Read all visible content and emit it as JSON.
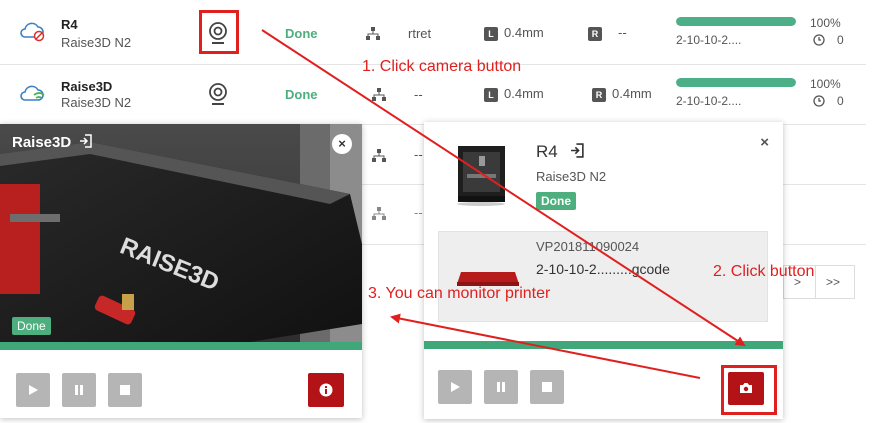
{
  "rows": [
    {
      "name": "R4",
      "model": "Raise3D N2",
      "status": "Done",
      "job": "rtret",
      "nozzle_left_tag": "L",
      "nozzle_left": "0.4mm",
      "nozzle_right_tag": "R",
      "nozzle_right": "--",
      "progress": 1.0,
      "progress_text": "100%",
      "file": "2-10-10-2....",
      "time": "0"
    },
    {
      "name": "Raise3D",
      "model": "Raise3D N2",
      "status": "Done",
      "job": "--",
      "nozzle_left_tag": "L",
      "nozzle_left": "0.4mm",
      "nozzle_right_tag": "R",
      "nozzle_right": "0.4mm",
      "progress": 1.0,
      "progress_text": "100%",
      "file": "2-10-10-2....",
      "time": "0"
    }
  ],
  "hidden_rows": [
    {
      "job": "--"
    },
    {
      "job": "--"
    }
  ],
  "camera_popup": {
    "title": "Raise3D",
    "close": "×",
    "status": "Done"
  },
  "detail_popup": {
    "name": "R4",
    "model": "Raise3D N2",
    "status": "Done",
    "close": "×",
    "job_id": "VP201811090024",
    "job_file": "2-10-10-2.........gcode"
  },
  "pager": {
    "next": ">",
    "last": ">>"
  },
  "annotations": {
    "step1": "1. Click camera button",
    "step2": "2. Click button",
    "step3": "3. You can monitor printer"
  },
  "colors": {
    "accent_green": "#3fa77a",
    "danger_red": "#b31217",
    "annotation_red": "#e0201f"
  },
  "icons": [
    "cloud-offline-icon",
    "cloud-wifi-icon",
    "webcam-icon",
    "network-icon",
    "login-icon",
    "play-icon",
    "pause-icon",
    "stop-icon",
    "info-icon",
    "camera-icon",
    "clock-icon"
  ]
}
